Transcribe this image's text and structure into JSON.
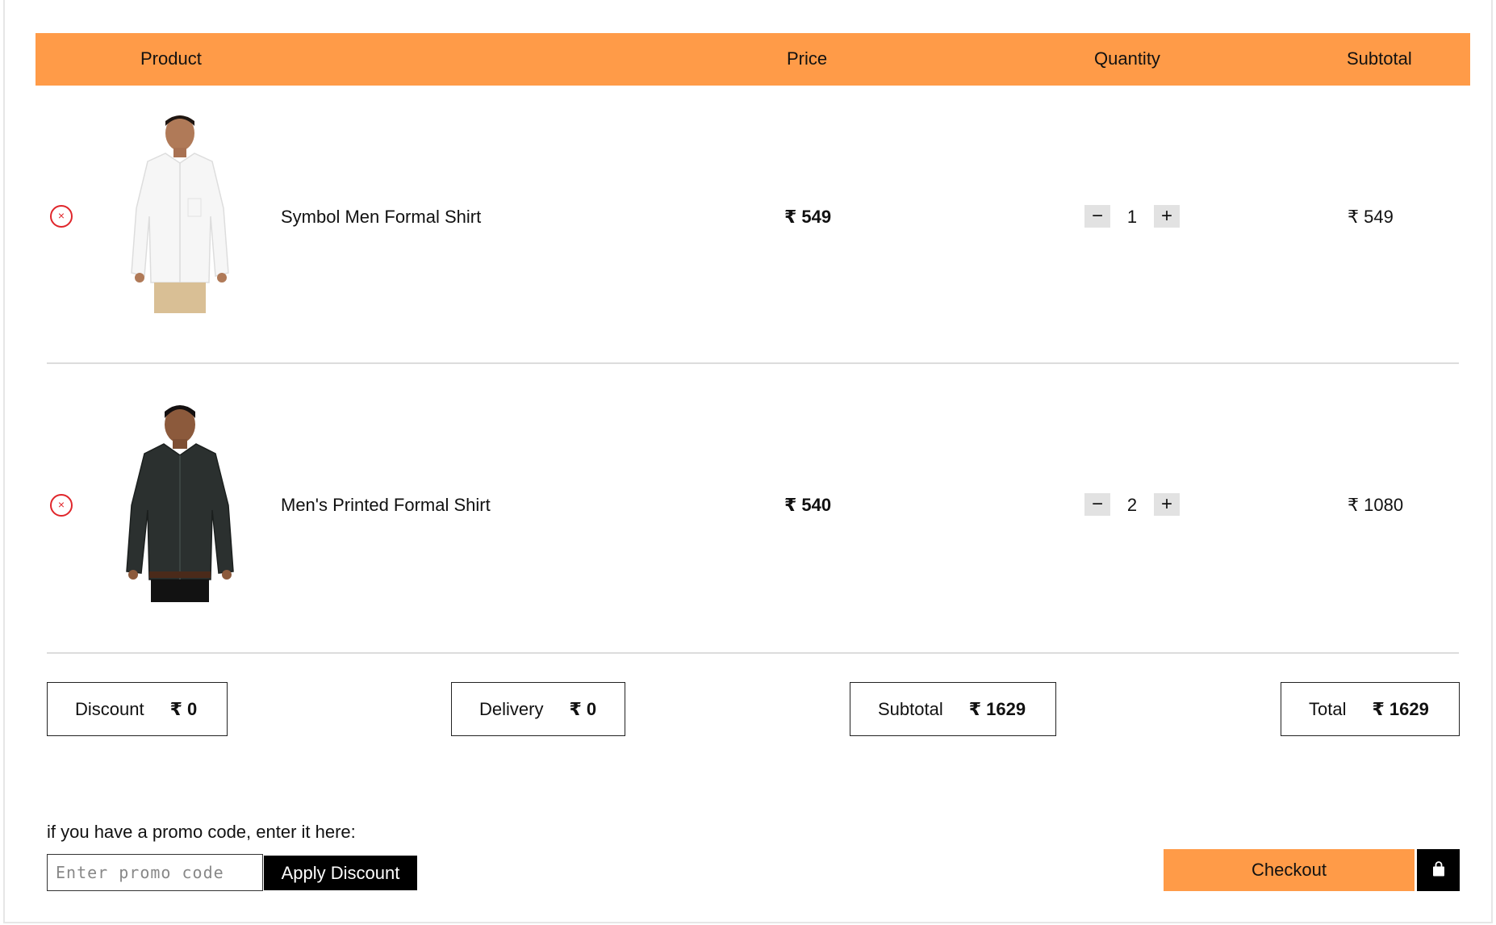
{
  "table_header": {
    "product": "Product",
    "price": "Price",
    "quantity": "Quantity",
    "subtotal": "Subtotal"
  },
  "cart_items": [
    {
      "name": "Symbol Men Formal Shirt",
      "price": "₹ 549",
      "quantity": "1",
      "subtotal": "₹ 549",
      "shirt_color": "#f4f4f4"
    },
    {
      "name": "Men's Printed Formal Shirt",
      "price": "₹ 540",
      "quantity": "2",
      "subtotal": "₹ 1080",
      "shirt_color": "#2b302f"
    }
  ],
  "controls": {
    "remove": "×",
    "minus": "−",
    "plus": "+"
  },
  "summary": {
    "discount_label": "Discount",
    "discount_value": "₹ 0",
    "delivery_label": "Delivery",
    "delivery_value": "₹ 0",
    "subtotal_label": "Subtotal",
    "subtotal_value": "₹ 1629",
    "total_label": "Total",
    "total_value": "₹ 1629"
  },
  "promo": {
    "label": "if you have a promo code, enter it here:",
    "placeholder": "Enter promo code",
    "apply_label": "Apply Discount"
  },
  "checkout": {
    "label": "Checkout",
    "icon": "shopping-bag-icon"
  },
  "colors": {
    "accent": "#ff9b48",
    "remove": "#e0262b"
  }
}
